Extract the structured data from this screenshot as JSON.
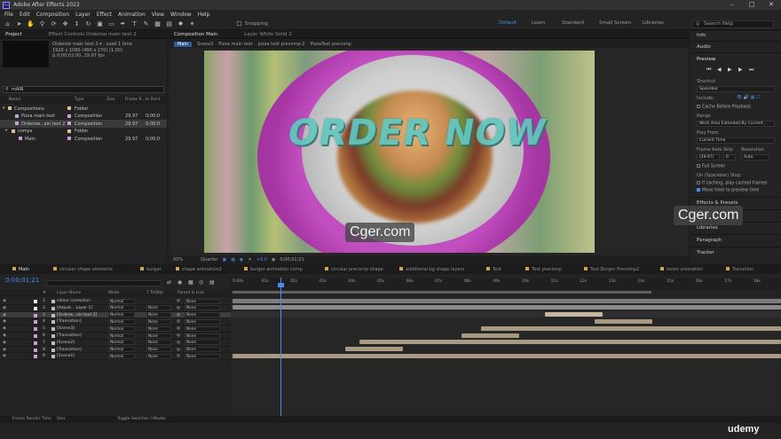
{
  "window": {
    "title": "Adobe After Effects 2022",
    "logo": "Ae"
  },
  "menu": [
    "File",
    "Edit",
    "Composition",
    "Layer",
    "Effect",
    "Animation",
    "View",
    "Window",
    "Help"
  ],
  "toolbar": {
    "snapping_label": "Snapping",
    "workspaces": [
      "Default",
      "Learn",
      "Standard",
      "Small Screen",
      "Libraries"
    ],
    "active_workspace": "Default",
    "search_placeholder": "Search Help"
  },
  "project_panel": {
    "tabs": [
      "Project",
      "Effect Controls Orderow main text 2"
    ],
    "selected_info": [
      "Orderow main text 2 ▾ , used 1 time",
      "1920 x 1080  (480 x 270) (1.00)",
      "Δ 0;00;02;00, 29.97 fps"
    ],
    "search_value": "mAIN",
    "columns": [
      "Name",
      "Type",
      "Size",
      "Frame R...",
      "In Point"
    ],
    "rows": [
      {
        "name": "Compositions",
        "type": "Folder",
        "size": "",
        "fr": "",
        "in": "",
        "indent": 0,
        "swatch": "#d8c08c",
        "twirl": "▾"
      },
      {
        "name": "Pizza main text",
        "type": "Composition",
        "size": "",
        "fr": "29.97",
        "in": "0;00;0",
        "indent": 2,
        "swatch": "#c9a0d6",
        "twirl": ""
      },
      {
        "name": "Orderow...ain text 2",
        "type": "Composition",
        "size": "",
        "fr": "29.97",
        "in": "0;00;0",
        "indent": 2,
        "swatch": "#c9a0d6",
        "twirl": ""
      },
      {
        "name": "comps",
        "type": "Folder",
        "size": "",
        "fr": "",
        "in": "",
        "indent": 1,
        "swatch": "#d8c08c",
        "twirl": "▾"
      },
      {
        "name": "Main",
        "type": "Composition",
        "size": "",
        "fr": "29.97",
        "in": "0;00;0",
        "indent": 3,
        "swatch": "#c9a0d6",
        "twirl": ""
      }
    ],
    "footer": "8 bpc"
  },
  "comp_panel": {
    "tabs": [
      "Composition Main",
      "Layer White Solid 2"
    ],
    "breadcrumbs": [
      "Main",
      "Scene3",
      "Pizza main text",
      "pizza text precomp-2",
      "PizzaText precomp"
    ],
    "active_breadcrumb": "Main",
    "canvas_text": "ORDER NOW",
    "watermark": "Cger.com",
    "footer": {
      "zoom": "50%",
      "quality": "Quarter",
      "exposure": "+0.0",
      "timecode": "0;00;01;21"
    }
  },
  "right_panel": {
    "sections": [
      "Info",
      "Audio",
      "Preview"
    ],
    "shortcut_label": "Shortcut",
    "shortcut_value": "Spacebar",
    "include_label": "Include:",
    "cache_label": "Cache Before Playback",
    "range_label": "Range",
    "range_value": "Work Area Extended By Current...",
    "play_from_label": "Play From",
    "play_from_value": "Current Time",
    "frame_rate_label": "Frame Rate",
    "skip_label": "Skip",
    "resolution_label": "Resolution",
    "frame_rate_value": "(29.97)",
    "skip_value": "0",
    "resolution_value": "Auto",
    "full_screen_label": "Full Screen",
    "stop_label": "On (Spacebar) Stop:",
    "if_caching_label": "If caching, play cached frames",
    "move_time_label": "Move time to preview time",
    "more_sections": [
      "Effects & Presets",
      "Align",
      "Libraries",
      "Paragraph",
      "Tracker"
    ]
  },
  "timeline": {
    "tabs": [
      "Main",
      "circular shape elements",
      "burger",
      "shape animation2",
      "burger animation comp",
      "circular precomp shape",
      "additional bg shape layers",
      "Text",
      "Text precomp",
      "Text Burger Precomp2",
      "boom animation",
      "Transition"
    ],
    "active_tab": "Main",
    "current_time": "0;00;01;21",
    "columns": [
      "#",
      "Layer Name",
      "Mode",
      "T TrkMat",
      "Parent & Link"
    ],
    "ruler_labels": [
      "0:00s",
      "01s",
      "02s",
      "03s",
      "04s",
      "05s",
      "06s",
      "07s",
      "08s",
      "09s",
      "10s",
      "11s",
      "12s",
      "13s",
      "14s",
      "15s",
      "16s",
      "17s",
      "18s"
    ],
    "layers": [
      {
        "num": "1",
        "name": "colour correction",
        "mode": "Normal",
        "trk": "",
        "parent": "None",
        "color": "#e6e6e6",
        "start": 0,
        "end": 19,
        "bar": "#7d7d7d"
      },
      {
        "num": "2",
        "name": "[Adjust... Layer 1]",
        "mode": "Normal",
        "trk": "None",
        "parent": "None",
        "color": "#e6e6e6",
        "start": 0,
        "end": 19,
        "bar": "#8a8a8a"
      },
      {
        "num": "3",
        "name": "[Orderw...ain text 2]",
        "mode": "Normal",
        "trk": "None",
        "parent": "None",
        "color": "#c9a0d6",
        "start": 10.8,
        "end": 12.8,
        "bar": "#c8b6a0"
      },
      {
        "num": "4",
        "name": "[Transistion]",
        "mode": "Normal",
        "trk": "None",
        "parent": "None",
        "color": "#c9a0d6",
        "start": 12.5,
        "end": 14.5,
        "bar": "#a89a82"
      },
      {
        "num": "5",
        "name": "[Scene3]",
        "mode": "Normal",
        "trk": "None",
        "parent": "None",
        "color": "#c9a0d6",
        "start": 8.6,
        "end": 19,
        "bar": "#a89a82"
      },
      {
        "num": "6",
        "name": "[Transistion]",
        "mode": "Normal",
        "trk": "None",
        "parent": "None",
        "color": "#c9a0d6",
        "start": 7.9,
        "end": 9.9,
        "bar": "#a89a82"
      },
      {
        "num": "7",
        "name": "[Scene2]",
        "mode": "Normal",
        "trk": "None",
        "parent": "None",
        "color": "#c9a0d6",
        "start": 4.4,
        "end": 19,
        "bar": "#a89a82"
      },
      {
        "num": "8",
        "name": "[Transistion]",
        "mode": "Normal",
        "trk": "None",
        "parent": "None",
        "color": "#c9a0d6",
        "start": 3.9,
        "end": 5.9,
        "bar": "#a89a82"
      },
      {
        "num": "9",
        "name": "[Scene1]",
        "mode": "Normal",
        "trk": "None",
        "parent": "None",
        "color": "#c9a0d6",
        "start": 0,
        "end": 19,
        "bar": "#a89a82"
      }
    ],
    "footer": {
      "render_label": "Frame Render Time",
      "render_value": "0ms",
      "toggle_label": "Toggle Switches / Modes"
    }
  },
  "branding": "udemy"
}
